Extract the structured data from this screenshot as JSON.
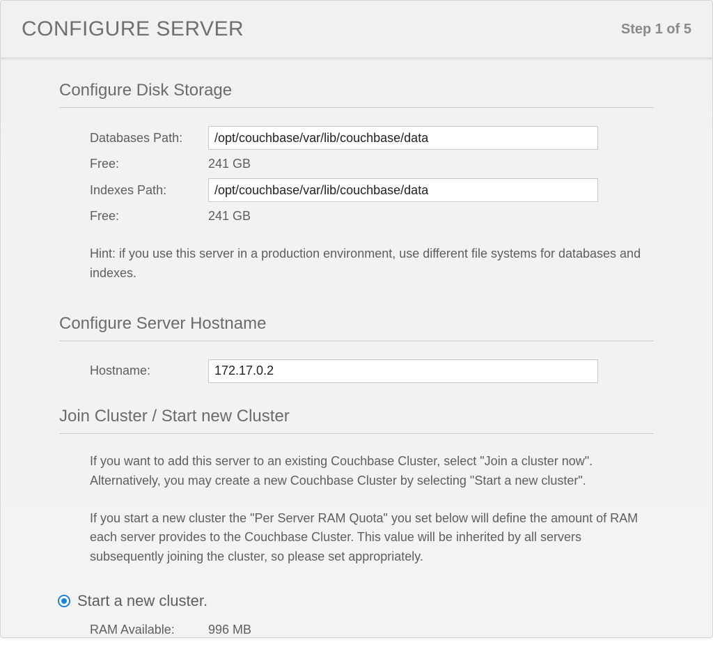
{
  "header": {
    "title": "CONFIGURE SERVER",
    "step": "Step 1 of 5"
  },
  "disk": {
    "title": "Configure Disk Storage",
    "databases_path_label": "Databases Path:",
    "databases_path_value": "/opt/couchbase/var/lib/couchbase/data",
    "databases_free_label": "Free:",
    "databases_free_value": "241 GB",
    "indexes_path_label": "Indexes Path:",
    "indexes_path_value": "/opt/couchbase/var/lib/couchbase/data",
    "indexes_free_label": "Free:",
    "indexes_free_value": "241 GB",
    "hint": "Hint: if you use this server in a production environment, use different file systems for databases and indexes."
  },
  "hostname": {
    "title": "Configure Server Hostname",
    "label": "Hostname:",
    "value": "172.17.0.2"
  },
  "cluster": {
    "title": "Join Cluster / Start new Cluster",
    "para1": "If you want to add this server to an existing Couchbase Cluster, select \"Join a cluster now\". Alternatively, you may create a new Couchbase Cluster by selecting \"Start a new cluster\".",
    "para2": "If you start a new cluster the \"Per Server RAM Quota\" you set below will define the amount of RAM each server provides to the Couchbase Cluster. This value will be inherited by all servers subsequently joining the cluster, so please set appropriately.",
    "radio_start_label": "Start a new cluster.",
    "ram_available_label": "RAM Available:",
    "ram_available_value": "996 MB"
  }
}
